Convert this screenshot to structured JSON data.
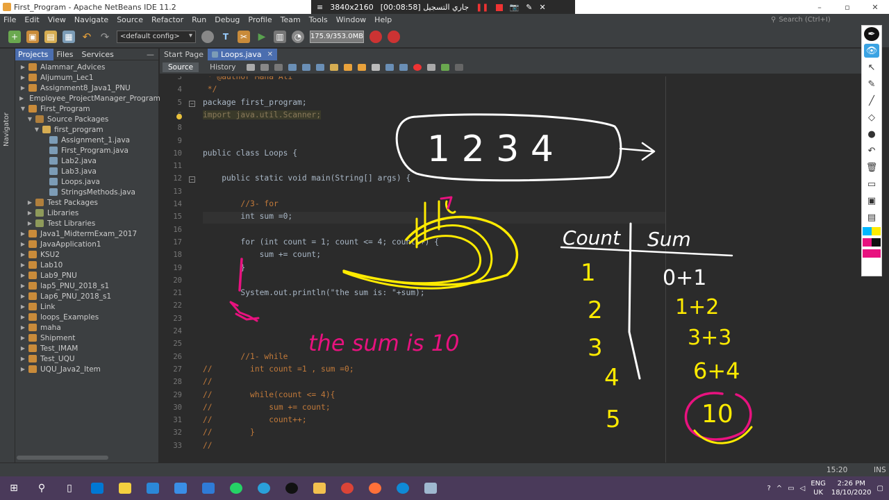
{
  "window": {
    "title": "First_Program - Apache NetBeans IDE 11.2",
    "min": "–",
    "max": "▫",
    "close": "✕"
  },
  "recorder": {
    "menu_icon": "≡",
    "resolution": "3840x2160",
    "timer": "[00:08:58] جاري التسجيل",
    "pause_icon": "❚❚",
    "camera_icon": "📷",
    "pen_icon": "✎",
    "close_icon": "✕"
  },
  "menu": {
    "items": [
      "File",
      "Edit",
      "View",
      "Navigate",
      "Source",
      "Refactor",
      "Run",
      "Debug",
      "Profile",
      "Team",
      "Tools",
      "Window",
      "Help"
    ],
    "search_placeholder": "Search (Ctrl+I)"
  },
  "toolbar": {
    "config": "<default config>",
    "memory": "175.9/353.0MB"
  },
  "navigator": {
    "label": "Navigator"
  },
  "projects_panel": {
    "tabs": [
      "Projects",
      "Files",
      "Services"
    ],
    "minimize": "—",
    "tree": [
      {
        "label": "Alammar_Advices",
        "depth": 0,
        "expanded": false,
        "icon": "project"
      },
      {
        "label": "Aljumum_Lec1",
        "depth": 0,
        "expanded": false,
        "icon": "project"
      },
      {
        "label": "Assignment8_Java1_PNU",
        "depth": 0,
        "expanded": false,
        "icon": "project"
      },
      {
        "label": "Employee_ProjectManager_Programm",
        "depth": 0,
        "expanded": false,
        "icon": "project"
      },
      {
        "label": "First_Program",
        "depth": 0,
        "expanded": true,
        "icon": "project"
      },
      {
        "label": "Source Packages",
        "depth": 1,
        "expanded": true,
        "icon": "packages"
      },
      {
        "label": "first_program",
        "depth": 2,
        "expanded": true,
        "icon": "package"
      },
      {
        "label": "Assignment_1.java",
        "depth": 3,
        "expanded": null,
        "icon": "java"
      },
      {
        "label": "First_Program.java",
        "depth": 3,
        "expanded": null,
        "icon": "java"
      },
      {
        "label": "Lab2.java",
        "depth": 3,
        "expanded": null,
        "icon": "java"
      },
      {
        "label": "Lab3.java",
        "depth": 3,
        "expanded": null,
        "icon": "java"
      },
      {
        "label": "Loops.java",
        "depth": 3,
        "expanded": null,
        "icon": "java"
      },
      {
        "label": "StringsMethods.java",
        "depth": 3,
        "expanded": null,
        "icon": "java"
      },
      {
        "label": "Test Packages",
        "depth": 1,
        "expanded": false,
        "icon": "packages"
      },
      {
        "label": "Libraries",
        "depth": 1,
        "expanded": false,
        "icon": "library"
      },
      {
        "label": "Test Libraries",
        "depth": 1,
        "expanded": false,
        "icon": "library"
      },
      {
        "label": "Java1_MidtermExam_2017",
        "depth": 0,
        "expanded": false,
        "icon": "project"
      },
      {
        "label": "JavaApplication1",
        "depth": 0,
        "expanded": false,
        "icon": "project"
      },
      {
        "label": "KSU2",
        "depth": 0,
        "expanded": false,
        "icon": "project"
      },
      {
        "label": "Lab10",
        "depth": 0,
        "expanded": false,
        "icon": "project"
      },
      {
        "label": "Lab9_PNU",
        "depth": 0,
        "expanded": false,
        "icon": "project"
      },
      {
        "label": "lap5_PNU_2018_s1",
        "depth": 0,
        "expanded": false,
        "icon": "project"
      },
      {
        "label": "Lap6_PNU_2018_s1",
        "depth": 0,
        "expanded": false,
        "icon": "project"
      },
      {
        "label": "Link",
        "depth": 0,
        "expanded": false,
        "icon": "project"
      },
      {
        "label": "loops_Examples",
        "depth": 0,
        "expanded": false,
        "icon": "project"
      },
      {
        "label": "maha",
        "depth": 0,
        "expanded": false,
        "icon": "project"
      },
      {
        "label": "Shipment",
        "depth": 0,
        "expanded": false,
        "icon": "project"
      },
      {
        "label": "Test_IMAM",
        "depth": 0,
        "expanded": false,
        "icon": "project"
      },
      {
        "label": "Test_UQU",
        "depth": 0,
        "expanded": false,
        "icon": "project"
      },
      {
        "label": "UQU_Java2_Item",
        "depth": 0,
        "expanded": false,
        "icon": "project"
      }
    ]
  },
  "editor": {
    "tabs": [
      {
        "label": "Start Page",
        "active": false
      },
      {
        "label": "Loops.java",
        "active": true
      }
    ],
    "close_icon": "✕",
    "modes": [
      "Source",
      "History"
    ],
    "lines": [
      {
        "n": "3",
        "text": " * @author Maha Ali",
        "cls": "cm"
      },
      {
        "n": "4",
        "text": " */",
        "cls": "cm"
      },
      {
        "n": "5",
        "text": "package first_program;",
        "cls": ""
      },
      {
        "n": "6",
        "text": "import java.util.Scanner;",
        "cls": "dim"
      },
      {
        "n": "8",
        "text": "",
        "cls": ""
      },
      {
        "n": "9",
        "text": "",
        "cls": ""
      },
      {
        "n": "10",
        "text": "public class Loops {",
        "cls": ""
      },
      {
        "n": "11",
        "text": "",
        "cls": ""
      },
      {
        "n": "12",
        "text": "    public static void main(String[] args) {",
        "cls": ""
      },
      {
        "n": "13",
        "text": "",
        "cls": ""
      },
      {
        "n": "14",
        "text": "        //3- for",
        "cls": "cm"
      },
      {
        "n": "15",
        "text": "        int sum =0;",
        "cls": ""
      },
      {
        "n": "16",
        "text": "",
        "cls": ""
      },
      {
        "n": "17",
        "text": "        for (int count = 1; count <= 4; count++) {",
        "cls": ""
      },
      {
        "n": "18",
        "text": "            sum += count;",
        "cls": ""
      },
      {
        "n": "19",
        "text": "        }",
        "cls": ""
      },
      {
        "n": "20",
        "text": "",
        "cls": ""
      },
      {
        "n": "21",
        "text": "        System.out.println(\"the sum is: \"+sum);",
        "cls": ""
      },
      {
        "n": "22",
        "text": "",
        "cls": ""
      },
      {
        "n": "23",
        "text": "",
        "cls": ""
      },
      {
        "n": "24",
        "text": "",
        "cls": ""
      },
      {
        "n": "25",
        "text": "",
        "cls": ""
      },
      {
        "n": "26",
        "text": "        //1- while",
        "cls": "cm"
      },
      {
        "n": "27",
        "text": "//        int count =1 , sum =0;",
        "cls": "cm"
      },
      {
        "n": "28",
        "text": "//",
        "cls": "cm"
      },
      {
        "n": "29",
        "text": "//        while(count <= 4){",
        "cls": "cm"
      },
      {
        "n": "30",
        "text": "//            sum += count;",
        "cls": "cm"
      },
      {
        "n": "31",
        "text": "//            count++;",
        "cls": "cm"
      },
      {
        "n": "32",
        "text": "//        }",
        "cls": "cm"
      },
      {
        "n": "33",
        "text": "//",
        "cls": "cm"
      }
    ]
  },
  "status": {
    "position": "15:20",
    "mode": "INS"
  },
  "annotations": {
    "box_digits": "1 2 3   4",
    "sum_note": "the sum is 10",
    "table_header_count": "Count",
    "table_header_sum": "Sum",
    "count_values": [
      "1",
      "2",
      "3",
      "4",
      "5"
    ],
    "sum_values": [
      "0+1",
      "1+2",
      "3+3",
      "6+4",
      "10"
    ],
    "ink_colors": {
      "yellow": "#ffeb00",
      "pink": "#e8127f",
      "white": "#ffffff"
    }
  },
  "taskbar": {
    "lang": "ENG",
    "region": "UK",
    "time": "2:26 PM",
    "date": "18/10/2020"
  }
}
